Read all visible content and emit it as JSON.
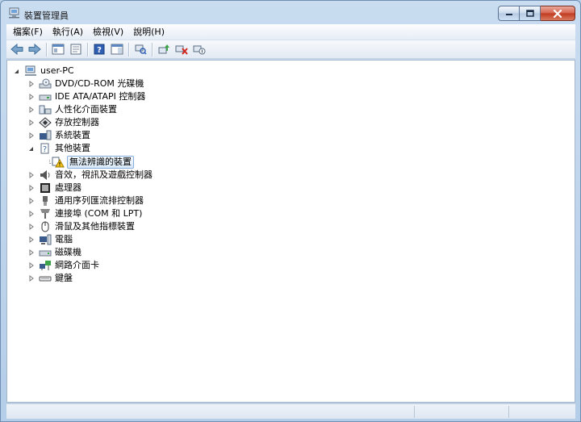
{
  "window": {
    "title": "裝置管理員",
    "minimize_glyph": "—",
    "maximize_glyph": "□",
    "close_glyph": "✕",
    "icon": "device-manager-icon"
  },
  "menu": [
    "檔案(F)",
    "執行(A)",
    "檢視(V)",
    "說明(H)"
  ],
  "toolbar": [
    {
      "name": "back-icon",
      "type": "button"
    },
    {
      "name": "forward-icon",
      "type": "button"
    },
    {
      "name": "separator"
    },
    {
      "name": "show-hide-console-tree-icon",
      "type": "button"
    },
    {
      "name": "properties-icon",
      "type": "button"
    },
    {
      "name": "separator"
    },
    {
      "name": "help-icon",
      "type": "button"
    },
    {
      "name": "action-pane-icon",
      "type": "button"
    },
    {
      "name": "separator"
    },
    {
      "name": "scan-hardware-icon",
      "type": "button"
    },
    {
      "name": "separator"
    },
    {
      "name": "update-driver-icon",
      "type": "button"
    },
    {
      "name": "uninstall-device-icon",
      "type": "button"
    },
    {
      "name": "disable-device-icon",
      "type": "button"
    }
  ],
  "tree": {
    "root": {
      "label": "user-PC",
      "expanded": true,
      "icon": "computer-icon"
    },
    "nodes": [
      {
        "label": "DVD/CD-ROM 光碟機",
        "icon": "dvd-drive-icon",
        "expanded": false
      },
      {
        "label": "IDE ATA/ATAPI 控制器",
        "icon": "ide-controller-icon",
        "expanded": false
      },
      {
        "label": "人性化介面裝置",
        "icon": "hid-icon",
        "expanded": false
      },
      {
        "label": "存放控制器",
        "icon": "storage-controller-icon",
        "expanded": false
      },
      {
        "label": "系統裝置",
        "icon": "system-devices-icon",
        "expanded": false
      },
      {
        "label": "其他裝置",
        "icon": "other-devices-icon",
        "expanded": true,
        "children": [
          {
            "label": "無法辨識的裝置",
            "icon": "unknown-device-warning-icon",
            "selected": true
          }
        ]
      },
      {
        "label": "音效，視訊及遊戲控制器",
        "icon": "sound-icon",
        "expanded": false
      },
      {
        "label": "處理器",
        "icon": "processor-icon",
        "expanded": false
      },
      {
        "label": "通用序列匯流排控制器",
        "icon": "usb-icon",
        "expanded": false
      },
      {
        "label": "連接埠 (COM 和 LPT)",
        "icon": "ports-icon",
        "expanded": false
      },
      {
        "label": "滑鼠及其他指標裝置",
        "icon": "mouse-icon",
        "expanded": false
      },
      {
        "label": "電腦",
        "icon": "computer-category-icon",
        "expanded": false
      },
      {
        "label": "磁碟機",
        "icon": "disk-drive-icon",
        "expanded": false
      },
      {
        "label": "網路介面卡",
        "icon": "network-adapter-icon",
        "expanded": false
      },
      {
        "label": "鍵盤",
        "icon": "keyboard-icon",
        "expanded": false
      }
    ]
  },
  "colors": {
    "frame": "#b4cde8",
    "selection_border": "#84acdd",
    "close_button": "#c0391f"
  }
}
